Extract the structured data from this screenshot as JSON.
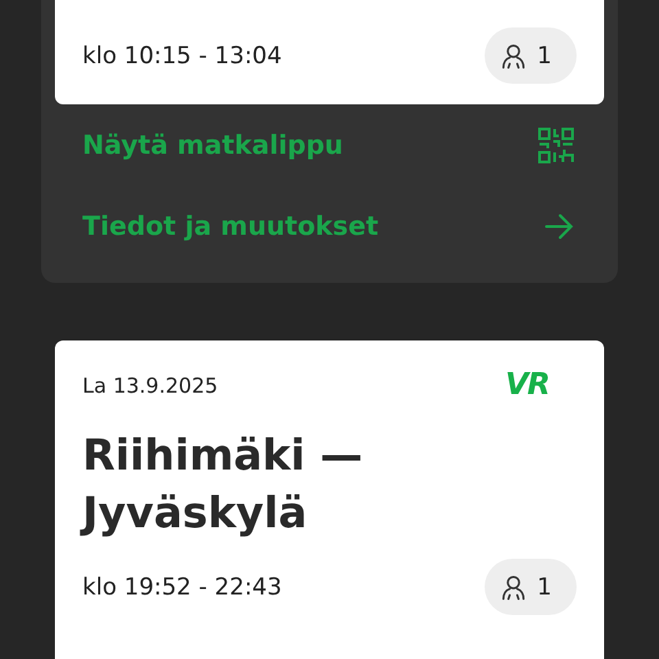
{
  "trips": [
    {
      "time": "klo 10:15 - 13:04",
      "passengers": "1",
      "actions": [
        {
          "label": "Näytä matkalippu",
          "kind": "qr"
        },
        {
          "label": "Tiedot ja muutokset",
          "kind": "arrow"
        }
      ]
    },
    {
      "date": "La 13.9.2025",
      "logo": "VR",
      "route": "Riihimäki — Jyväskylä",
      "time": "klo 19:52 - 22:43",
      "passengers": "1"
    }
  ]
}
